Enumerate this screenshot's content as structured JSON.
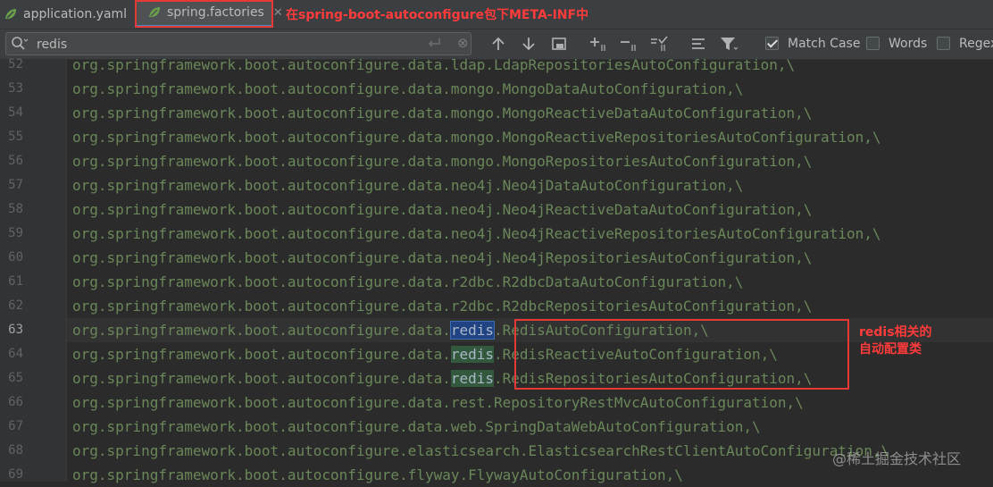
{
  "tabs": [
    {
      "label": "application.yaml",
      "active": false
    },
    {
      "label": "spring.factories",
      "active": true
    }
  ],
  "tab_annotation": "在spring-boot-autoconfigure包下META-INF中",
  "search": {
    "value": "redis",
    "options": [
      {
        "label": "Match Case",
        "checked": true
      },
      {
        "label": "Words",
        "checked": false
      },
      {
        "label": "Regex",
        "checked": false
      }
    ]
  },
  "lines": [
    {
      "num": "52",
      "text": "org.springframework.boot.autoconfigure.data.ldap.LdapRepositoriesAutoConfiguration,\\"
    },
    {
      "num": "53",
      "text": "org.springframework.boot.autoconfigure.data.mongo.MongoDataAutoConfiguration,\\"
    },
    {
      "num": "54",
      "text": "org.springframework.boot.autoconfigure.data.mongo.MongoReactiveDataAutoConfiguration,\\"
    },
    {
      "num": "55",
      "text": "org.springframework.boot.autoconfigure.data.mongo.MongoReactiveRepositoriesAutoConfiguration,\\"
    },
    {
      "num": "56",
      "text": "org.springframework.boot.autoconfigure.data.mongo.MongoRepositoriesAutoConfiguration,\\"
    },
    {
      "num": "57",
      "text": "org.springframework.boot.autoconfigure.data.neo4j.Neo4jDataAutoConfiguration,\\"
    },
    {
      "num": "58",
      "text": "org.springframework.boot.autoconfigure.data.neo4j.Neo4jReactiveDataAutoConfiguration,\\"
    },
    {
      "num": "59",
      "text": "org.springframework.boot.autoconfigure.data.neo4j.Neo4jReactiveRepositoriesAutoConfiguration,\\"
    },
    {
      "num": "60",
      "text": "org.springframework.boot.autoconfigure.data.neo4j.Neo4jRepositoriesAutoConfiguration,\\"
    },
    {
      "num": "61",
      "text": "org.springframework.boot.autoconfigure.data.r2dbc.R2dbcDataAutoConfiguration,\\"
    },
    {
      "num": "62",
      "text": "org.springframework.boot.autoconfigure.data.r2dbc.R2dbcRepositoriesAutoConfiguration,\\"
    },
    {
      "num": "63",
      "pre": "org.springframework.boot.autoconfigure.data.",
      "match": "redis",
      "post": ".RedisAutoConfiguration,\\",
      "current": true
    },
    {
      "num": "64",
      "pre": "org.springframework.boot.autoconfigure.data.",
      "match": "redis",
      "post": ".RedisReactiveAutoConfiguration,\\"
    },
    {
      "num": "65",
      "pre": "org.springframework.boot.autoconfigure.data.",
      "match": "redis",
      "post": ".RedisRepositoriesAutoConfiguration,\\"
    },
    {
      "num": "66",
      "text": "org.springframework.boot.autoconfigure.data.rest.RepositoryRestMvcAutoConfiguration,\\"
    },
    {
      "num": "67",
      "text": "org.springframework.boot.autoconfigure.data.web.SpringDataWebAutoConfiguration,\\"
    },
    {
      "num": "68",
      "text": "org.springframework.boot.autoconfigure.elasticsearch.ElasticsearchRestClientAutoConfiguration,\\"
    },
    {
      "num": "69",
      "text": "org.springframework.boot.autoconfigure.flyway.FlywayAutoConfiguration,\\"
    }
  ],
  "annotation_redis": [
    "redis相关的",
    "自动配置类"
  ],
  "watermark": "@稀土掘金技术社区"
}
